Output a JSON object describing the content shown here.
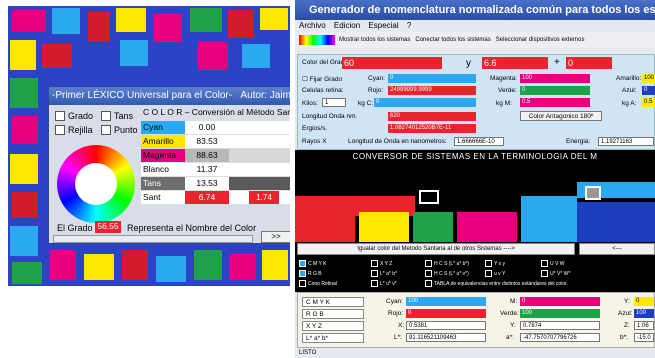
{
  "left_window": {
    "title": "-Primer LÉXICO Universal para el Color-",
    "author": "Autor: Jaime",
    "checkboxes": [
      "Grado",
      "Tans",
      "Rejilla",
      "Punto"
    ],
    "conversion_title": "C O L O R – Conversión al Método Santana -",
    "colors": [
      {
        "name": "Cyan",
        "value": "0.00",
        "name_color": "#2ba9f0",
        "swatch": "#ffffff"
      },
      {
        "name": "Amarillo",
        "value": "83.53",
        "name_color": "#ffe800",
        "swatch": "#ffffff"
      },
      {
        "name": "Magenta",
        "value": "88.63",
        "name_color": "#e6007e",
        "swatch": "#d8d8d8"
      },
      {
        "name": "Blanco",
        "value": "11.37",
        "name_color": "#ffffff",
        "swatch": "#ffffff"
      },
      {
        "name": "Tans",
        "value": "13.53",
        "name_color": "#6e6e6e",
        "swatch": "#5a5a5a"
      }
    ],
    "sant_label": "Sant",
    "sant_value": "6.74",
    "sant_extra": "1.74",
    "grado_label": "El Grado",
    "grado_value": "56.55",
    "grado_desc": "Representa el Nombre del Color",
    "nav_next": ">>"
  },
  "right_window": {
    "title": "Generador de nomenclatura normalizada común para todos los están",
    "menu": [
      "Archivo",
      "Edicion",
      "Especial",
      "?"
    ],
    "toolbar": [
      "Mostrar todos los sistemas",
      "Conectar todos los sistemas",
      "Seleccionar dispositivos externos"
    ],
    "ctrl": {
      "color_grado_label": "Color del Grado:",
      "color_grado_value": "60",
      "y_label": "y",
      "y_value": "6.6",
      "plus": "+",
      "plus_value": "0",
      "fijar_grado": "Fijar Grado",
      "cyan_label": "Cyan:",
      "cyan_value": "0",
      "magenta_label": "Magenta:",
      "magenta_value": "100",
      "amarillo_label": "Amarillo:",
      "amarillo_value": "100",
      "celulas_label": "Celulas retina:",
      "rojo_label": "Rojo:",
      "rojo_value": "24999999.9999",
      "verde_label": "Verde:",
      "verde_value": "0",
      "azul_label": "Azul:",
      "azul_value": "0",
      "kilos_label": "Kilos:",
      "kilos_value": "1",
      "kgc_label": "kg C:",
      "kgc_value": "0",
      "kgm_label": "kg M:",
      "kgm_value": "0.5",
      "kga_label": "kg A:",
      "kga_value": "0.5",
      "longitud_label": "Longitud Onda nm.",
      "longitud_value": "620",
      "antagonico": "Color Antagonico 180º",
      "ergios_label": "Ergios/s.",
      "ergios_value": "1.08274012520B7E-11",
      "rayos_label": "Rayos X",
      "onda_metros_label": "Longitud de Onda en nanometros:",
      "onda_metros_value": "1.666666E-10",
      "energia_label": "Energia:",
      "energia_value": "1.19271163"
    },
    "banner": "CONVERSOR DE SISTEMAS EN LA TERMINOLOGIA DEL M",
    "igualar_button": "Igualar color del Metodo Santana al de otros Sistemas ---->",
    "right_button": "<---",
    "systems": [
      {
        "label": "C M Y K",
        "checked": true
      },
      {
        "label": "X Y Z",
        "checked": false
      },
      {
        "label": "H C S (L* a* b*)",
        "checked": false
      },
      {
        "label": "Y x y",
        "checked": false
      },
      {
        "label": "U V W",
        "checked": false
      },
      {
        "label": "R G B",
        "checked": true
      },
      {
        "label": "L* a* b*",
        "checked": false
      },
      {
        "label": "H C S (L* u* v*)",
        "checked": false
      },
      {
        "label": "u v Y",
        "checked": false
      },
      {
        "label": "U* V* W*",
        "checked": false
      },
      {
        "label": "Cono Retinal",
        "checked": false
      },
      {
        "label": "L* u* v*",
        "checked": false
      },
      {
        "label": "TABLA de equivalencias entre distintos estándares del color.",
        "checked": false
      }
    ],
    "bottom": {
      "rows": [
        "C M Y K",
        "R G B",
        "X Y Z",
        "L* a* b*"
      ],
      "cyan_label": "Cyan:",
      "cyan_value": "100",
      "m_label": "M:",
      "m_value": "0",
      "y_label": "Y:",
      "y_value": "0",
      "rojo_label": "Rojo:",
      "rojo_value": "0",
      "verde_label": "Verde:",
      "verde_value": "100",
      "azul_label": "Azul:",
      "azul_value": "100",
      "x_label": "X:",
      "x_value": "0.5381",
      "yy_label": "Y:",
      "yy_value": "0.7874",
      "z_label": "Z:",
      "z_value": "1.06",
      "l_label": "L*:",
      "l_value": "91.116521109463",
      "a_label": "a*:",
      "a_value": "-47.7570707796726",
      "b_label": "b*:",
      "b_value": "-15.0"
    },
    "status": "LISTO"
  }
}
